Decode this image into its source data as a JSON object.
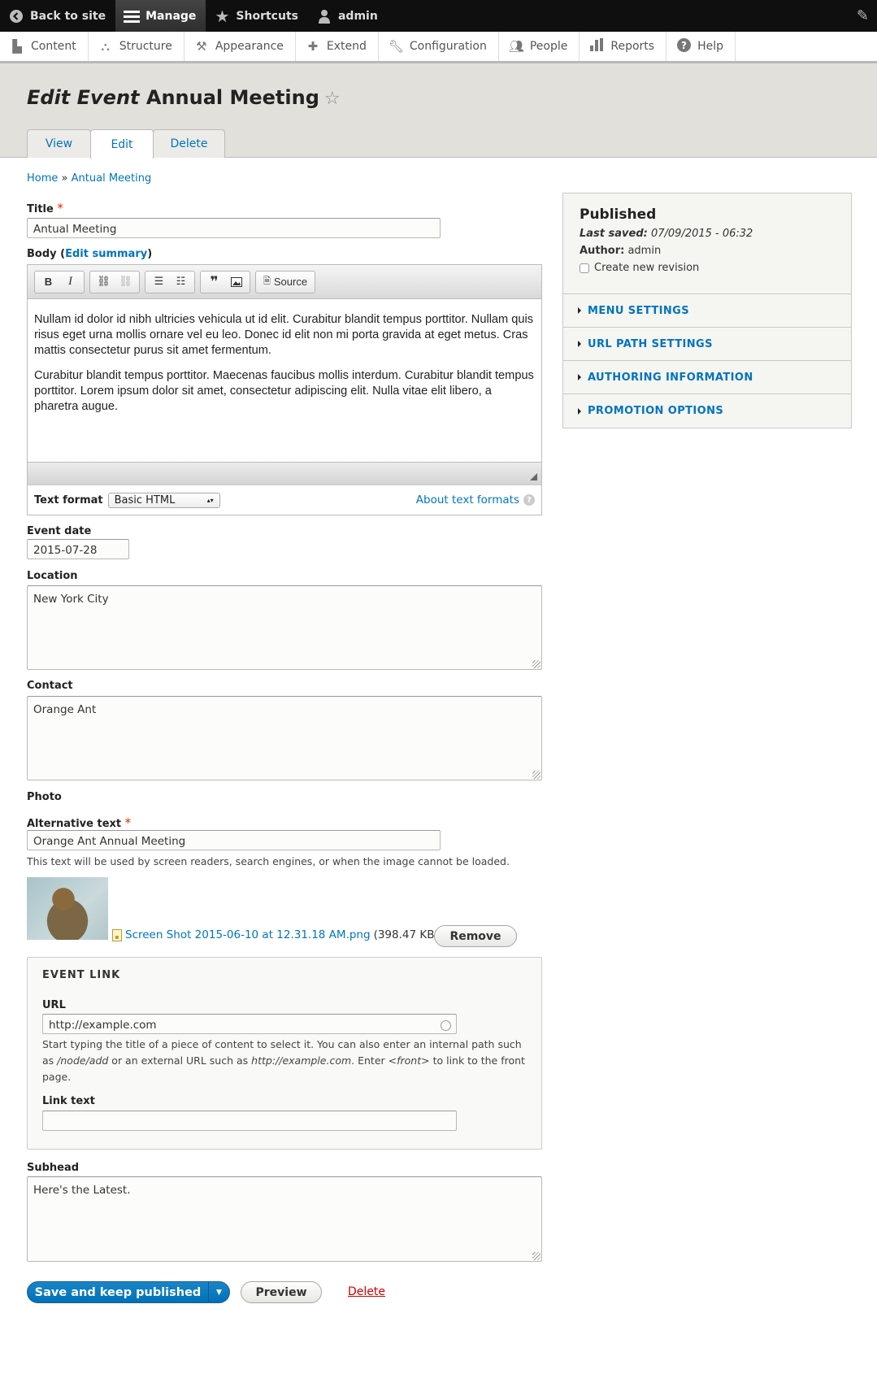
{
  "toolbar": {
    "back": "Back to site",
    "manage": "Manage",
    "shortcuts": "Shortcuts",
    "user": "admin"
  },
  "tray": {
    "items": [
      {
        "label": "Content",
        "icon": "page-icon"
      },
      {
        "label": "Structure",
        "icon": "sitemap-icon"
      },
      {
        "label": "Appearance",
        "icon": "paint-icon"
      },
      {
        "label": "Extend",
        "icon": "puzzle-icon"
      },
      {
        "label": "Configuration",
        "icon": "wrench-icon"
      },
      {
        "label": "People",
        "icon": "people-icon"
      },
      {
        "label": "Reports",
        "icon": "bar-chart-icon"
      },
      {
        "label": "Help",
        "icon": "help-icon"
      }
    ]
  },
  "header": {
    "title_prefix": "Edit Event",
    "title_node": "Annual Meeting",
    "tabs": [
      "View",
      "Edit",
      "Delete"
    ],
    "active_tab": "Edit"
  },
  "breadcrumb": {
    "home": "Home",
    "sep": "»",
    "current": "Antual Meeting"
  },
  "form": {
    "title_label": "Title",
    "title_value": "Antual Meeting",
    "body_label": "Body",
    "edit_summary": "Edit summary",
    "editor_buttons": [
      "Bold",
      "Italic",
      "Link",
      "Unlink",
      "Bulleted list",
      "Numbered list",
      "Blockquote",
      "Image",
      "Source"
    ],
    "source_label": "Source",
    "body_paragraphs": [
      "Nullam id dolor id nibh ultricies vehicula ut id elit. Curabitur blandit tempus porttitor. Nullam quis risus eget urna mollis ornare vel eu leo. Donec id elit non mi porta gravida at eget metus. Cras mattis consectetur purus sit amet fermentum.",
      "Curabitur blandit tempus porttitor. Maecenas faucibus mollis interdum. Curabitur blandit tempus porttitor. Lorem ipsum dolor sit amet, consectetur adipiscing elit. Nulla vitae elit libero, a pharetra augue."
    ],
    "text_format_label": "Text format",
    "text_format_value": "Basic HTML",
    "about_formats": "About text formats",
    "event_date_label": "Event date",
    "event_date_value": "2015-07-28",
    "location_label": "Location",
    "location_value": "New York City",
    "contact_label": "Contact",
    "contact_value": "Orange Ant",
    "photo_label": "Photo",
    "alt_label": "Alternative text",
    "alt_value": "Orange Ant Annual Meeting",
    "alt_desc": "This text will be used by screen readers, search engines, or when the image cannot be loaded.",
    "file_name": "Screen Shot 2015-06-10 at 12.31.18 AM.png",
    "file_size": "(398.47 KB)",
    "remove_label": "Remove",
    "event_link": {
      "legend": "EVENT LINK",
      "url_label": "URL",
      "url_value": "http://example.com",
      "url_desc_1": "Start typing the title of a piece of content to select it. You can also enter an internal path such as",
      "url_desc_path": "/node/add",
      "url_desc_2": " or an external URL such as ",
      "url_desc_ext": "http://example.com",
      "url_desc_3": ". Enter ",
      "url_desc_front": "<front>",
      "url_desc_4": " to link to the front page.",
      "link_text_label": "Link text",
      "link_text_value": ""
    },
    "subhead_label": "Subhead",
    "subhead_value": "Here's the Latest."
  },
  "actions": {
    "save": "Save and keep published",
    "preview": "Preview",
    "delete": "Delete"
  },
  "sidebar": {
    "status": "Published",
    "last_saved_label": "Last saved:",
    "last_saved_value": "07/09/2015 - 06:32",
    "author_label": "Author:",
    "author_value": "admin",
    "revision_label": "Create new revision",
    "revision_checked": false,
    "sections": [
      "MENU SETTINGS",
      "URL PATH SETTINGS",
      "AUTHORING INFORMATION",
      "PROMOTION OPTIONS"
    ]
  },
  "colors": {
    "link": "#0074bd",
    "primary": "#0071b8",
    "danger": "#c00000",
    "required": "#e62600"
  }
}
